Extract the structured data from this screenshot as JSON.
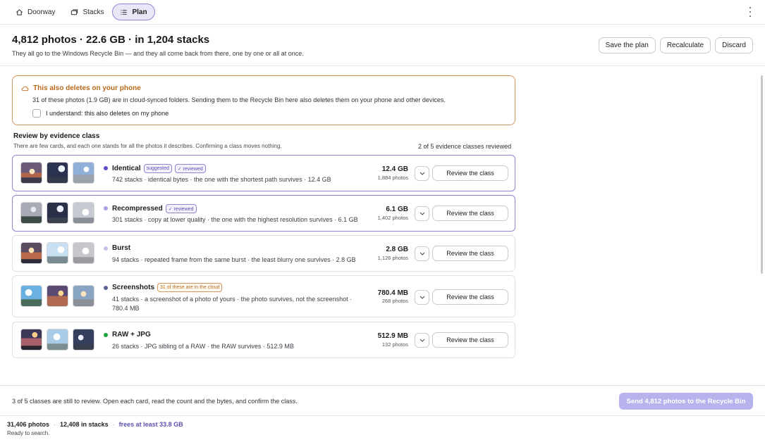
{
  "nav": {
    "tabs": [
      {
        "label": "Doorway",
        "icon": "home-icon"
      },
      {
        "label": "Stacks",
        "icon": "stacks-icon"
      },
      {
        "label": "Plan",
        "icon": "list-icon",
        "active": true
      }
    ]
  },
  "header": {
    "title": "4,812 photos · 22.6 GB · in 1,204 stacks",
    "subtitle": "They all go to the Windows Recycle Bin — and they all come back from there, one by one or all at once.",
    "buttons": {
      "save": "Save the plan",
      "recalc": "Recalculate",
      "discard": "Discard"
    }
  },
  "warning": {
    "icon": "cloud-icon",
    "title": "This also deletes on your phone",
    "body": "31 of these photos (1.9 GB) are in cloud-synced folders. Sending them to the Recycle Bin here also deletes them on your phone and other devices.",
    "checkbox_label": "I understand: this also deletes on my phone"
  },
  "review": {
    "title": "Review by evidence class",
    "subtitle": "There are few cards, and each one stands for all the photos it describes. Confirming a class moves nothing.",
    "count": "2 of 5 evidence classes reviewed",
    "button_label": "Review the class",
    "classes": [
      {
        "name": "Identical",
        "badges": [
          "suggested",
          "✓ reviewed"
        ],
        "desc": "742 stacks · identical bytes · the one with the shortest path survives · 12.4 GB",
        "size": "12.4 GB",
        "photos": "1,884 photos",
        "dot": "#5a4fc8",
        "reviewed": true
      },
      {
        "name": "Recompressed",
        "badges": [
          "✓ reviewed"
        ],
        "desc": "301 stacks · copy at lower quality · the one with the highest resolution survives · 6.1 GB",
        "size": "6.1 GB",
        "photos": "1,402 photos",
        "dot": "#a9a3e6",
        "reviewed": true
      },
      {
        "name": "Burst",
        "badges": [],
        "desc": "94 stacks · repeated frame from the same burst · the least blurry one survives · 2.8 GB",
        "size": "2.8 GB",
        "photos": "1,126 photos",
        "dot": "#c3c0ea",
        "reviewed": false
      },
      {
        "name": "Screenshots",
        "badges": [
          "31 of these are in the cloud"
        ],
        "desc": "41 stacks · a screenshot of a photo of yours · the photo survives, not the screenshot · 780.4 MB",
        "size": "780.4 MB",
        "photos": "268 photos",
        "dot": "#5a6090",
        "reviewed": false
      },
      {
        "name": "RAW + JPG",
        "badges": [],
        "desc": "26 stacks · JPG sibling of a RAW · the RAW survives · 512.9 MB",
        "size": "512.9 MB",
        "photos": "132 photos",
        "dot": "#1aa33a",
        "reviewed": false
      }
    ]
  },
  "footer": {
    "text": "3 of 5 classes are still to review. Open each card, read the count and the bytes, and confirm the class.",
    "send": "Send 4,812 photos to the Recycle Bin"
  },
  "status": {
    "photos": "31,406 photos",
    "stacks": "12,408 in stacks",
    "frees": "frees at least 33.8 GB",
    "state": "Ready to search."
  }
}
